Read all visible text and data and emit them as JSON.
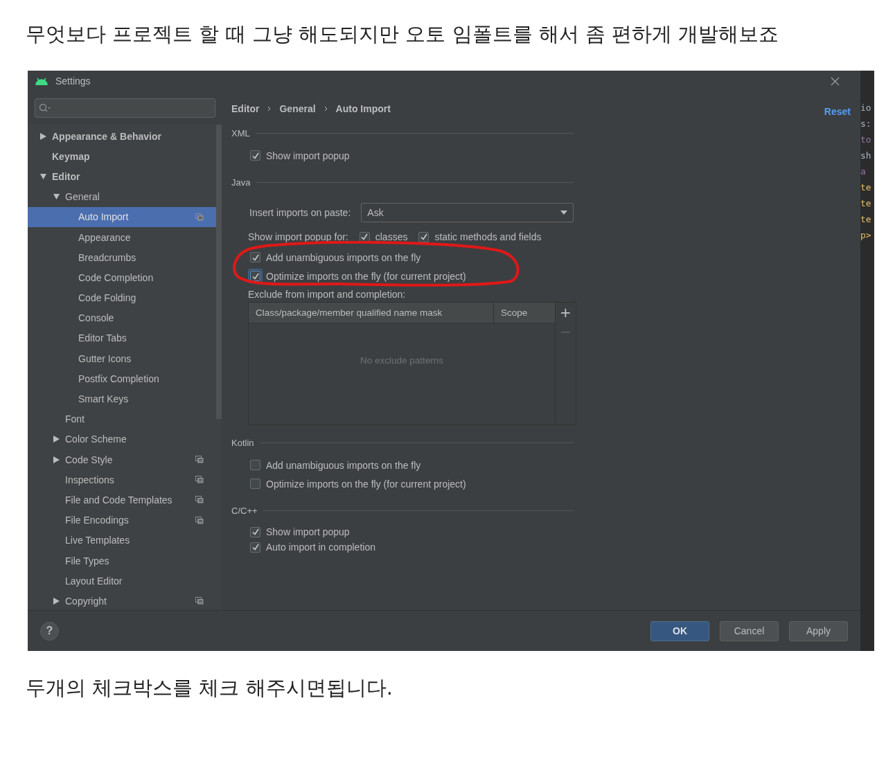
{
  "heading": "무엇보다 프로젝트 할 때 그냥 해도되지만  오토 임폴트를 해서 좀 편하게 개발해보죠",
  "window": {
    "title": "Settings"
  },
  "sidebar": {
    "items": [
      {
        "label": "Appearance & Behavior",
        "expanded": false,
        "selected": false,
        "project_level": false
      },
      {
        "label": "Keymap",
        "selected": false,
        "project_level": false
      },
      {
        "label": "Editor",
        "expanded": true,
        "selected": false,
        "project_level": false,
        "children": [
          {
            "label": "General",
            "expanded": true,
            "selected": false,
            "project_level": false,
            "children": [
              {
                "label": "Auto Import",
                "selected": true,
                "project_level": true
              },
              {
                "label": "Appearance",
                "selected": false,
                "project_level": false
              },
              {
                "label": "Breadcrumbs",
                "selected": false,
                "project_level": false
              },
              {
                "label": "Code Completion",
                "selected": false,
                "project_level": false
              },
              {
                "label": "Code Folding",
                "selected": false,
                "project_level": false
              },
              {
                "label": "Console",
                "selected": false,
                "project_level": false
              },
              {
                "label": "Editor Tabs",
                "selected": false,
                "project_level": false
              },
              {
                "label": "Gutter Icons",
                "selected": false,
                "project_level": false
              },
              {
                "label": "Postfix Completion",
                "selected": false,
                "project_level": false
              },
              {
                "label": "Smart Keys",
                "selected": false,
                "project_level": false
              }
            ]
          },
          {
            "label": "Font",
            "selected": false,
            "project_level": false
          },
          {
            "label": "Color Scheme",
            "expanded": false,
            "selected": false,
            "project_level": false
          },
          {
            "label": "Code Style",
            "expanded": false,
            "selected": false,
            "project_level": true
          },
          {
            "label": "Inspections",
            "selected": false,
            "project_level": true
          },
          {
            "label": "File and Code Templates",
            "selected": false,
            "project_level": true
          },
          {
            "label": "File Encodings",
            "selected": false,
            "project_level": true
          },
          {
            "label": "Live Templates",
            "selected": false,
            "project_level": false
          },
          {
            "label": "File Types",
            "selected": false,
            "project_level": false
          },
          {
            "label": "Layout Editor",
            "selected": false,
            "project_level": false
          },
          {
            "label": "Copyright",
            "expanded": false,
            "selected": false,
            "project_level": true
          }
        ]
      }
    ]
  },
  "breadcrumb": [
    "Editor",
    "General",
    "Auto Import"
  ],
  "reset_link": "Reset",
  "sections": [
    {
      "title": "XML",
      "rows": [
        {
          "kind": "checkbox",
          "label": "Show import popup",
          "checked": true,
          "focused": false
        }
      ]
    },
    {
      "title": "Java",
      "rows": [
        {
          "kind": "dropdown",
          "label": "Insert imports on paste:",
          "value": "Ask"
        },
        {
          "kind": "checkbox_group",
          "label": "Show import popup for:",
          "options": [
            {
              "label": "classes",
              "checked": true
            },
            {
              "label": "static methods and fields",
              "checked": true
            }
          ]
        },
        {
          "kind": "checkbox",
          "label": "Add unambiguous imports on the fly",
          "checked": true,
          "focused": false
        },
        {
          "kind": "checkbox",
          "label": "Optimize imports on the fly (for current project)",
          "checked": true,
          "focused": true
        },
        {
          "kind": "table",
          "label": "Exclude from import and completion:",
          "columns": [
            "Class/package/member qualified name mask",
            "Scope"
          ],
          "empty_text": "No exclude patterns",
          "add": "+",
          "remove": "−"
        }
      ]
    },
    {
      "title": "Kotlin",
      "rows": [
        {
          "kind": "checkbox",
          "label": "Add unambiguous imports on the fly",
          "checked": false,
          "focused": false
        },
        {
          "kind": "checkbox",
          "label": "Optimize imports on the fly (for current project)",
          "checked": false,
          "focused": false
        }
      ]
    },
    {
      "title": "C/C++",
      "rows": [
        {
          "kind": "checkbox",
          "label": "Show import popup",
          "checked": true,
          "focused": false
        },
        {
          "kind": "checkbox",
          "label": "Auto import in completion",
          "checked": true,
          "focused": false
        }
      ]
    }
  ],
  "help_button": "?",
  "buttons": [
    {
      "label": "OK",
      "kind": "primary"
    },
    {
      "label": "Cancel",
      "kind": "normal"
    },
    {
      "label": "Apply",
      "kind": "normal"
    }
  ],
  "background_code": [
    {
      "text": "io",
      "color": "#a9b7c6"
    },
    {
      "text": "s:",
      "color": "#a9b7c6"
    },
    {
      "text": "to",
      "color": "#9876aa"
    },
    {
      "text": "sh",
      "color": "#a9b7c6"
    },
    {
      "text": "a",
      "color": "#9876aa"
    },
    {
      "text": "te",
      "color": "#e8bf6a"
    },
    {
      "text": "te",
      "color": "#e8bf6a"
    },
    {
      "text": "te",
      "color": "#e8bf6a"
    },
    {
      "text": "p>",
      "color": "#e8bf6a"
    }
  ],
  "caption": "두개의 체크박스를 체크 해주시면됩니다."
}
